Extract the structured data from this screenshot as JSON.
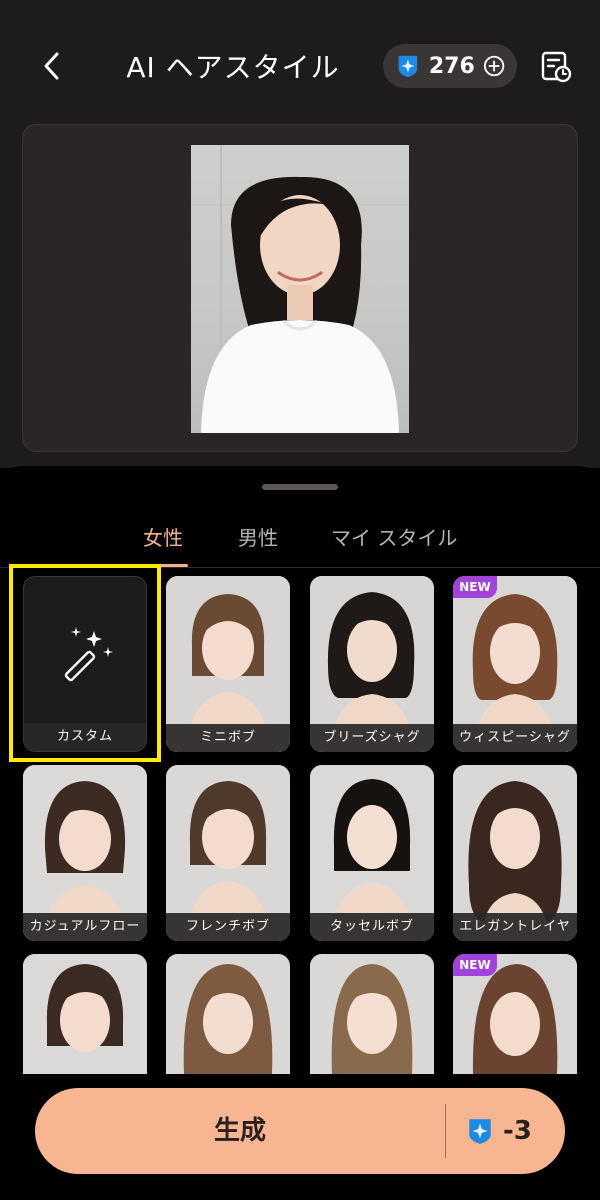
{
  "header": {
    "title": "AI ヘアスタイル",
    "credits": "276"
  },
  "tabs": [
    {
      "label": "女性",
      "active": true
    },
    {
      "label": "男性",
      "active": false
    },
    {
      "label": "マイ スタイル",
      "active": false
    }
  ],
  "styles": [
    {
      "label": "カスタム",
      "type": "custom",
      "selected": false,
      "badge": ""
    },
    {
      "label": "ミニボブ",
      "type": "preset",
      "selected": true,
      "badge": ""
    },
    {
      "label": "ブリーズシャグ",
      "type": "preset",
      "selected": false,
      "badge": ""
    },
    {
      "label": "ウィスピーシャグ",
      "type": "preset",
      "selected": false,
      "badge": "NEW"
    },
    {
      "label": "カジュアルフロー",
      "type": "preset",
      "selected": false,
      "badge": ""
    },
    {
      "label": "フレンチボブ",
      "type": "preset",
      "selected": false,
      "badge": ""
    },
    {
      "label": "タッセルボブ",
      "type": "preset",
      "selected": false,
      "badge": ""
    },
    {
      "label": "エレガントレイヤー",
      "type": "preset",
      "selected": false,
      "badge": ""
    },
    {
      "label": "",
      "type": "preset",
      "selected": false,
      "badge": ""
    },
    {
      "label": "",
      "type": "preset",
      "selected": false,
      "badge": ""
    },
    {
      "label": "",
      "type": "preset",
      "selected": false,
      "badge": ""
    },
    {
      "label": "",
      "type": "preset",
      "selected": false,
      "badge": "NEW"
    }
  ],
  "generate": {
    "label": "生成",
    "cost": "-3"
  },
  "colors": {
    "accent": "#f3b291",
    "button": "#f8b592",
    "badge": "#a142d9",
    "highlight": "#ffea00",
    "credit_icon": "#1e88e5"
  }
}
